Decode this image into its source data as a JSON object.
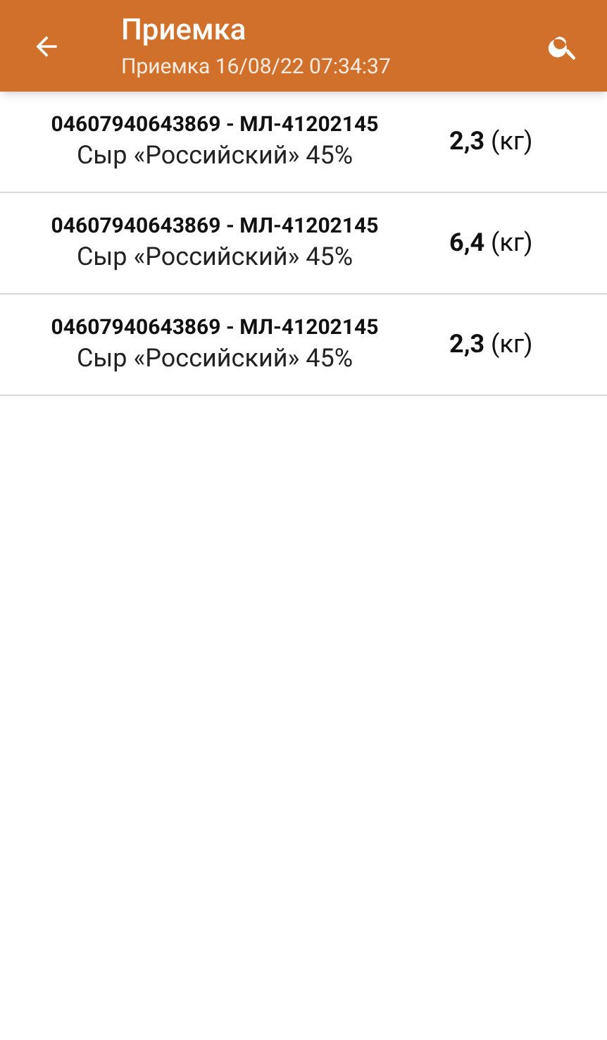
{
  "app_bar": {
    "title": "Приемка",
    "subtitle": "Приемка 16/08/22 07:34:37"
  },
  "items": [
    {
      "code": "04607940643869 - МЛ-41202145",
      "name": "Сыр «Российский» 45%",
      "quantity": "**2,3** (кг)"
    },
    {
      "code": "04607940643869 - МЛ-41202145",
      "name": "Сыр «Российский» 45%",
      "quantity": "**6,4** (кг)"
    },
    {
      "code": "04607940643869 - МЛ-41202145",
      "name": "Сыр «Российский» 45%",
      "quantity": "**2,3** (кг)"
    }
  ]
}
